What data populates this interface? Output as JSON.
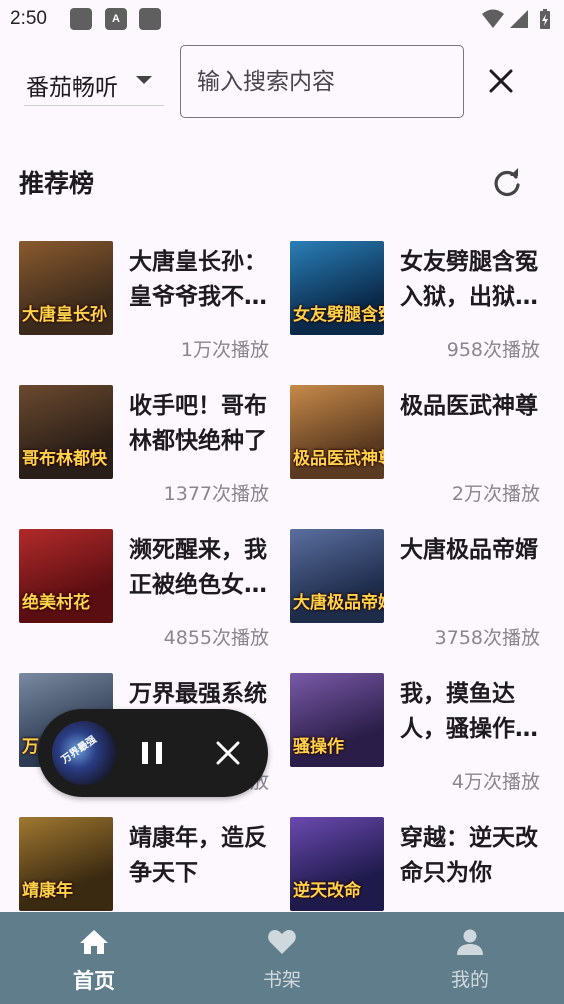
{
  "status_bar": {
    "time": "2:50",
    "notification_icons": [
      "app-icon",
      "a-icon",
      "app-icon"
    ],
    "system_icons": [
      "wifi-icon",
      "signal-icon",
      "battery-icon"
    ]
  },
  "search": {
    "source_selected": "番茄畅听",
    "placeholder": "输入搜索内容",
    "value": ""
  },
  "section": {
    "title": "推荐榜"
  },
  "books": [
    {
      "title": "大唐皇长孙：皇爷爷我不想当皇帝",
      "plays": "1万次播放",
      "cover_text": "大唐皇长孙",
      "cover_colors": [
        "#3b2a1c",
        "#8a5a2e"
      ]
    },
    {
      "title": "女友劈腿含冤入狱，出狱后我无敌了",
      "plays": "958次播放",
      "cover_text": "女友劈腿含冤入狱",
      "cover_colors": [
        "#0b2a4a",
        "#2a7fb8"
      ]
    },
    {
      "title": "收手吧！哥布林都快绝种了",
      "plays": "1377次播放",
      "cover_text": "哥布林都快",
      "cover_colors": [
        "#2a1e18",
        "#6b4a2f"
      ]
    },
    {
      "title": "极品医武神尊",
      "plays": "2万次播放",
      "cover_text": "极品医武神尊",
      "cover_colors": [
        "#5a3a20",
        "#c78a4a"
      ]
    },
    {
      "title": "濒死醒来，我正被绝色女帝拥入怀中",
      "plays": "4855次播放",
      "cover_text": "绝美村花",
      "cover_colors": [
        "#5a0e12",
        "#b22a2a"
      ]
    },
    {
      "title": "大唐极品帝婿",
      "plays": "3758次播放",
      "cover_text": "大唐极品帝婿",
      "cover_colors": [
        "#1e2c4a",
        "#5b6fa0"
      ]
    },
    {
      "title": "万界最强系统之召唤神魔",
      "plays": "2万次播放",
      "cover_text": "万界最强",
      "cover_colors": [
        "#2c3a52",
        "#7a8aa0"
      ]
    },
    {
      "title": "我，摸鱼达人，骚操作惊呆女主播",
      "plays": "4万次播放",
      "cover_text": "骚操作",
      "cover_colors": [
        "#2a1e48",
        "#7a5aa8"
      ]
    },
    {
      "title": "靖康年，造反争天下",
      "plays": "",
      "cover_text": "靖康年",
      "cover_colors": [
        "#3a2a12",
        "#a07830"
      ]
    },
    {
      "title": "穿越：逆天改命只为你",
      "plays": "",
      "cover_text": "逆天改命",
      "cover_colors": [
        "#1e1a4a",
        "#6a4ab0"
      ]
    }
  ],
  "mini_player": {
    "cover_text": "万界最强"
  },
  "nav": {
    "items": [
      {
        "label": "首页",
        "icon": "home-icon",
        "active": true
      },
      {
        "label": "书架",
        "icon": "heart-icon",
        "active": false
      },
      {
        "label": "我的",
        "icon": "person-icon",
        "active": false
      }
    ]
  },
  "colors": {
    "background": "#fdf7fe",
    "nav_bar": "#607d8b",
    "mini_player": "#1c1c1c",
    "play_count_text": "#8a858f"
  }
}
